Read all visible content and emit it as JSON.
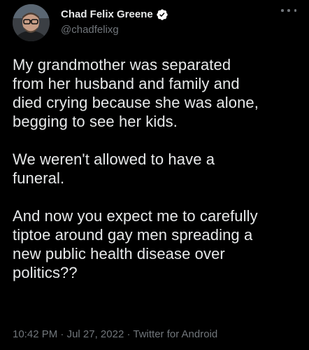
{
  "author": {
    "display_name": "Chad Felix Greene",
    "handle": "@chadfelixg",
    "verified": true,
    "verified_icon": "verified-badge-icon",
    "avatar_icon": "avatar"
  },
  "menu": {
    "icon": "more-options-icon"
  },
  "tweet": {
    "paragraphs": [
      "My grandmother was separated\nfrom her husband and family and\ndied crying because she was alone,\nbegging to see her kids.",
      "We weren't allowed to have a\nfuneral.",
      "And now you expect me to carefully\ntiptoe around gay men spreading a\nnew public health disease over\npolitics??"
    ]
  },
  "meta": {
    "time": "10:42 PM",
    "separator": " · ",
    "date": "Jul 27, 2022",
    "source": "Twitter for Android"
  },
  "colors": {
    "background": "#000000",
    "text": "#e7e9ea",
    "secondary_text": "#71767b",
    "verified_badge": "#ffffff"
  }
}
